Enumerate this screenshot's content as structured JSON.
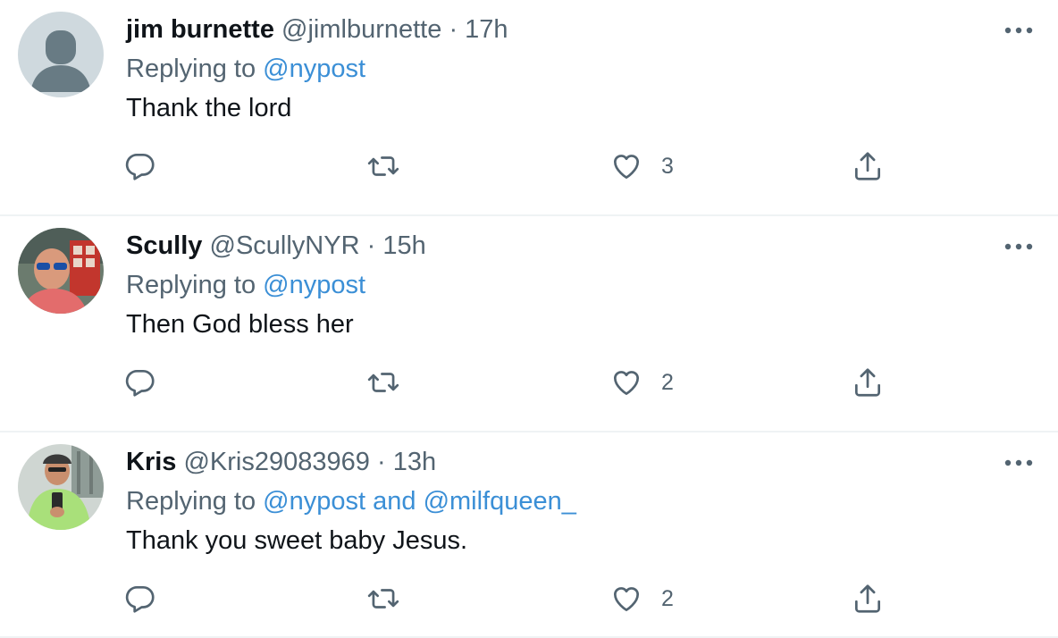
{
  "tweets": [
    {
      "name": "jim burnette",
      "handle": "@jimlburnette",
      "separator": "·",
      "time": "17h",
      "replying_prefix": "Replying to",
      "mention_1": "@nypost",
      "mention_joiner": "",
      "mention_2": "",
      "text": "Thank the lord",
      "like_count": "3",
      "avatar": "default-avatar"
    },
    {
      "name": "Scully",
      "handle": "@ScullyNYR",
      "separator": "·",
      "time": "15h",
      "replying_prefix": "Replying to",
      "mention_1": "@nypost",
      "mention_joiner": "",
      "mention_2": "",
      "text": "Then God bless her",
      "like_count": "2",
      "avatar": "photo-avatar"
    },
    {
      "name": "Kris",
      "handle": "@Kris29083969",
      "separator": "·",
      "time": "13h",
      "replying_prefix": "Replying to",
      "mention_1": "@nypost",
      "mention_joiner": "and",
      "mention_2": "@milfqueen_",
      "text": "Thank you sweet baby Jesus.",
      "like_count": "2",
      "avatar": "photo-avatar"
    }
  ],
  "icons": {
    "reply": "reply-icon",
    "retweet": "retweet-icon",
    "like": "heart-icon",
    "share": "share-icon",
    "more": "more-icon"
  },
  "colors": {
    "text": "#0f1419",
    "secondary": "#536471",
    "link": "#3b8fd6",
    "divider": "#eff3f4"
  }
}
